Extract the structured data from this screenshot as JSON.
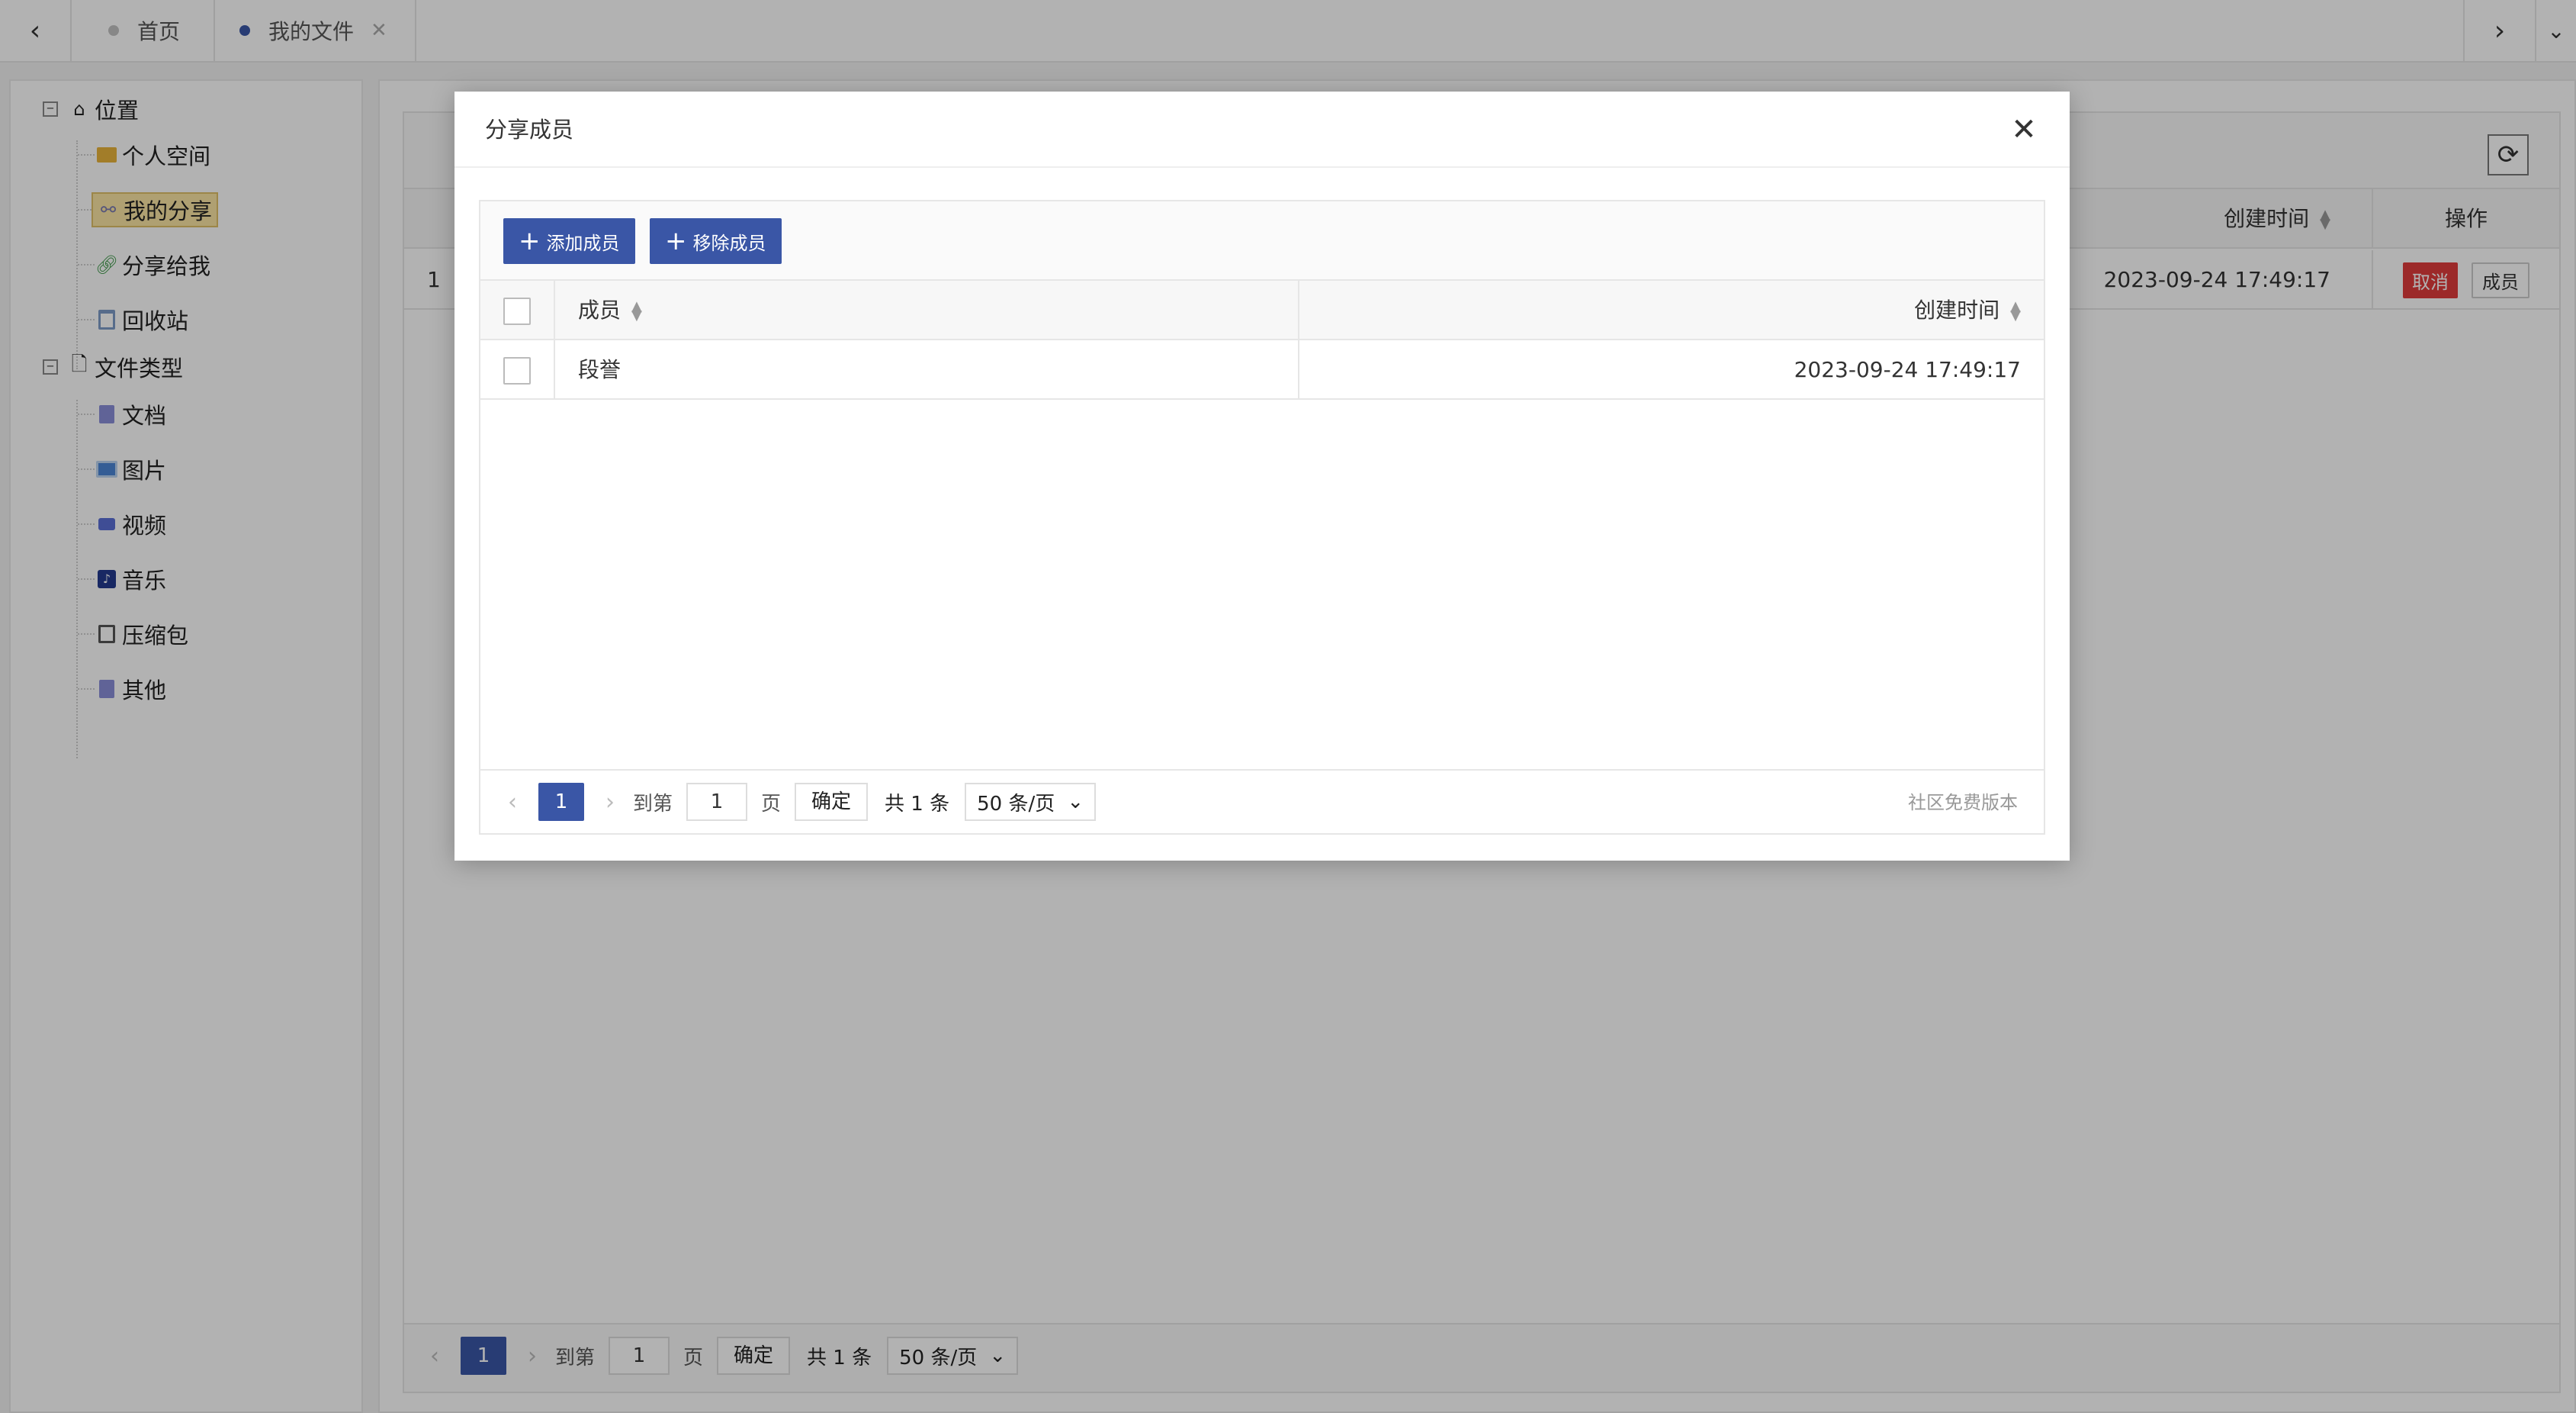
{
  "tabbar": {
    "prev_icon": "chevron-left-icon",
    "next_icon": "chevron-right-icon",
    "more_icon": "chevron-down-icon",
    "tabs": [
      {
        "label": "首页",
        "active": false,
        "closable": false
      },
      {
        "label": "我的文件",
        "active": true,
        "closable": true
      }
    ]
  },
  "sidebar": {
    "location": {
      "label": "位置",
      "items": [
        {
          "label": "个人空间",
          "icon": "folder-icon"
        },
        {
          "label": "我的分享",
          "icon": "share-icon",
          "selected": true
        },
        {
          "label": "分享给我",
          "icon": "link-icon"
        },
        {
          "label": "回收站",
          "icon": "trash-icon"
        }
      ]
    },
    "file_types": {
      "label": "文件类型",
      "items": [
        {
          "label": "文档",
          "icon": "document-icon"
        },
        {
          "label": "图片",
          "icon": "image-icon"
        },
        {
          "label": "视频",
          "icon": "video-icon"
        },
        {
          "label": "音乐",
          "icon": "music-icon"
        },
        {
          "label": "压缩包",
          "icon": "archive-icon"
        },
        {
          "label": "其他",
          "icon": "file-icon"
        }
      ]
    }
  },
  "main": {
    "columns": {
      "created_time": "创建时间",
      "operations": "操作"
    },
    "rows": [
      {
        "index": "1",
        "created_time": "2023-09-24 17:49:17",
        "cancel_label": "取消",
        "member_label": "成员"
      }
    ],
    "pager": {
      "current": "1",
      "goto_prefix": "到第",
      "goto_value": "1",
      "goto_suffix": "页",
      "ok_label": "确定",
      "total": "共 1 条",
      "page_size": "50 条/页"
    }
  },
  "modal": {
    "title": "分享成员",
    "add_label": "添加成员",
    "remove_label": "移除成员",
    "columns": {
      "member": "成员",
      "created_time": "创建时间"
    },
    "rows": [
      {
        "member": "段誉",
        "created_time": "2023-09-24 17:49:17"
      }
    ],
    "pager": {
      "current": "1",
      "goto_prefix": "到第",
      "goto_value": "1",
      "goto_suffix": "页",
      "ok_label": "确定",
      "total": "共 1 条",
      "page_size": "50 条/页"
    },
    "version": "社区免费版本"
  },
  "colors": {
    "accent": "#3a56a6",
    "danger": "#e03c3c",
    "selected_bg": "#fbe6a4"
  }
}
